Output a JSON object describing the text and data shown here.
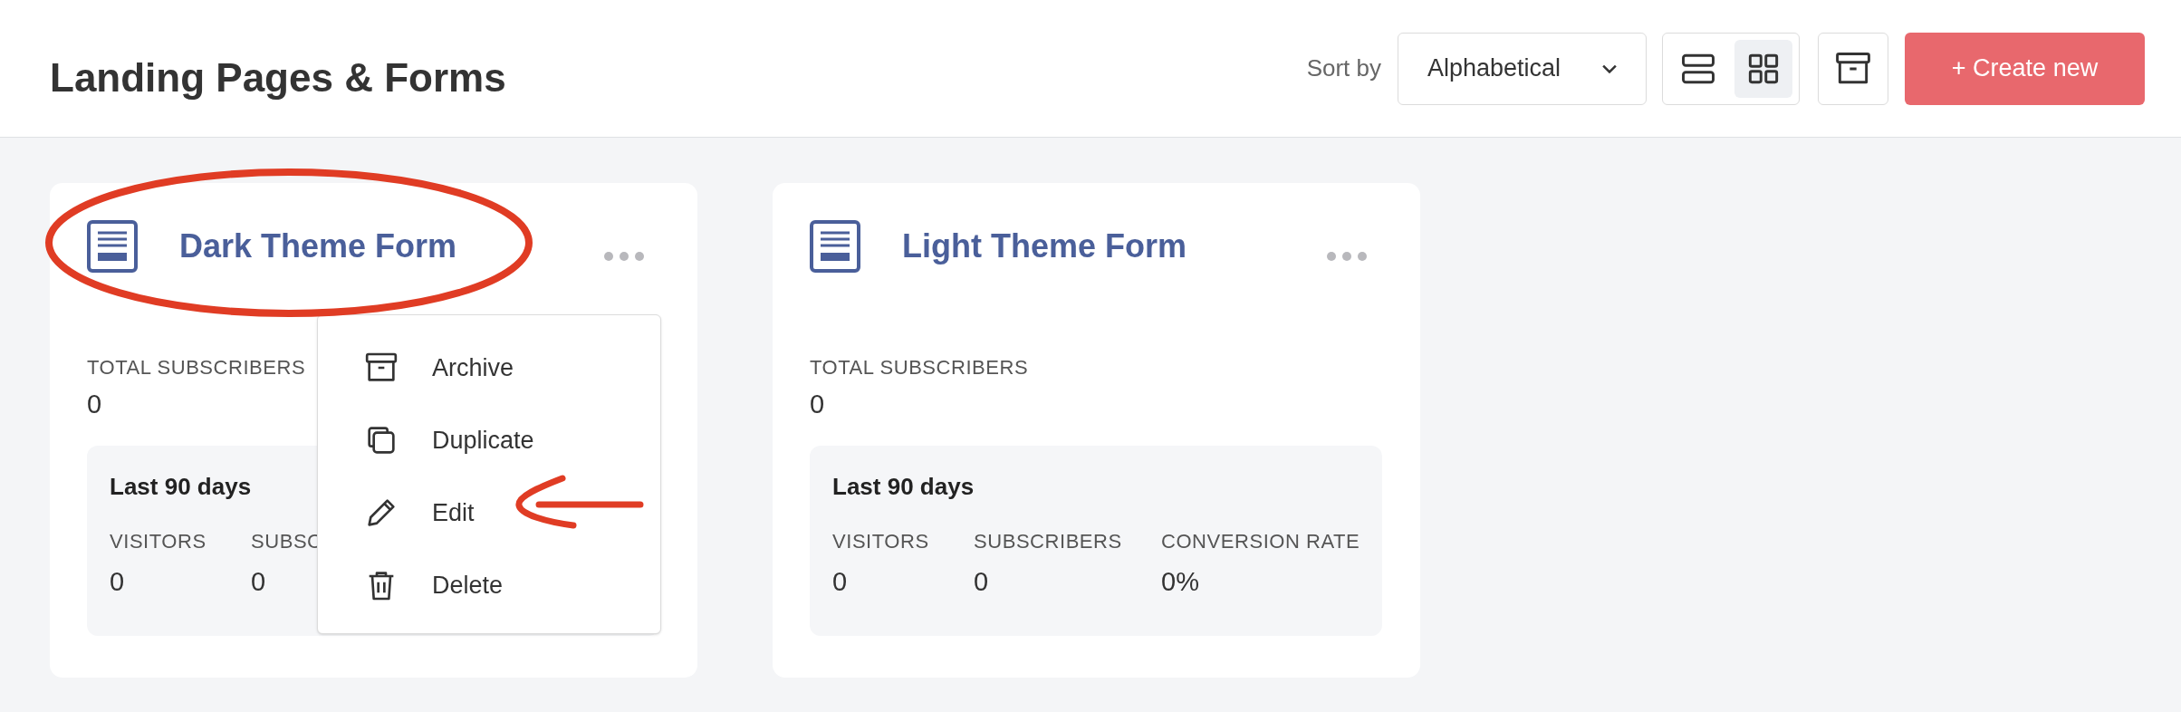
{
  "header": {
    "title": "Landing Pages & Forms",
    "sort_label": "Sort by",
    "sort_value": "Alphabetical",
    "view_toggle": [
      {
        "kind": "list",
        "selected": false
      },
      {
        "kind": "grid",
        "selected": true
      }
    ],
    "create_button": "+ Create new"
  },
  "cards": [
    {
      "title": "Dark Theme Form",
      "circled": true,
      "total_label": "TOTAL SUBSCRIBERS",
      "total_value": "0",
      "period": "Last 90 days",
      "stats": [
        {
          "label": "VISITORS",
          "value": "0"
        },
        {
          "label": "SUBSC",
          "value": "0"
        }
      ],
      "menu": [
        {
          "kind": "archive",
          "label": "Archive"
        },
        {
          "kind": "duplicate",
          "label": "Duplicate"
        },
        {
          "kind": "edit",
          "label": "Edit",
          "arrow": true
        },
        {
          "kind": "delete",
          "label": "Delete"
        }
      ]
    },
    {
      "title": "Light Theme Form",
      "circled": false,
      "total_label": "TOTAL SUBSCRIBERS",
      "total_value": "0",
      "period": "Last 90 days",
      "stats": [
        {
          "label": "VISITORS",
          "value": "0"
        },
        {
          "label": "SUBSCRIBERS",
          "value": "0"
        },
        {
          "label": "CONVERSION RATE",
          "value": "0%"
        }
      ]
    }
  ]
}
